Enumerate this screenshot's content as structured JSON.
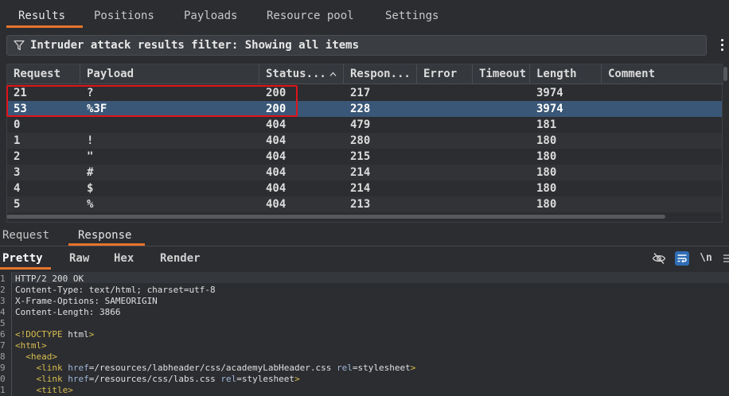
{
  "top_tabs": [
    "Results",
    "Positions",
    "Payloads",
    "Resource pool",
    "Settings"
  ],
  "filter": {
    "text": "Intruder attack results filter: Showing all items"
  },
  "table": {
    "columns": [
      "Request",
      "Payload",
      "Status...",
      "Respon...",
      "Error",
      "Timeout",
      "Length",
      "Comment"
    ],
    "sorted_column": "Status...",
    "rows": [
      {
        "request": "21",
        "payload": "?",
        "status": "200",
        "response": "217",
        "error": "",
        "timeout": "",
        "length": "3974",
        "comment": ""
      },
      {
        "request": "53",
        "payload": "%3F",
        "status": "200",
        "response": "228",
        "error": "",
        "timeout": "",
        "length": "3974",
        "comment": ""
      },
      {
        "request": "0",
        "payload": "",
        "status": "404",
        "response": "479",
        "error": "",
        "timeout": "",
        "length": "181",
        "comment": ""
      },
      {
        "request": "1",
        "payload": "!",
        "status": "404",
        "response": "280",
        "error": "",
        "timeout": "",
        "length": "180",
        "comment": ""
      },
      {
        "request": "2",
        "payload": "\"",
        "status": "404",
        "response": "215",
        "error": "",
        "timeout": "",
        "length": "180",
        "comment": ""
      },
      {
        "request": "3",
        "payload": "#",
        "status": "404",
        "response": "214",
        "error": "",
        "timeout": "",
        "length": "180",
        "comment": ""
      },
      {
        "request": "4",
        "payload": "$",
        "status": "404",
        "response": "214",
        "error": "",
        "timeout": "",
        "length": "180",
        "comment": ""
      },
      {
        "request": "5",
        "payload": "%",
        "status": "404",
        "response": "213",
        "error": "",
        "timeout": "",
        "length": "180",
        "comment": ""
      }
    ],
    "selected_request": "53"
  },
  "rr_tabs": [
    "Request",
    "Response"
  ],
  "view_tabs": [
    "Pretty",
    "Raw",
    "Hex",
    "Render"
  ],
  "toolbar": {
    "newline_label": "\\n"
  },
  "editor": {
    "lines": [
      {
        "num": "1",
        "text": "HTTP/2 200 OK"
      },
      {
        "num": "2",
        "text": "Content-Type: text/html; charset=utf-8"
      },
      {
        "num": "3",
        "text": "X-Frame-Options: SAMEORIGIN"
      },
      {
        "num": "4",
        "text": "Content-Length: 3866"
      },
      {
        "num": "5",
        "text": ""
      },
      {
        "num": "6",
        "text": "<!DOCTYPE html>"
      },
      {
        "num": "7",
        "text": "<html>"
      },
      {
        "num": "8",
        "text": "  <head>"
      },
      {
        "num": "9",
        "text": "    <link href=/resources/labheader/css/academyLabHeader.css rel=stylesheet>"
      },
      {
        "num": "0",
        "text": "    <link href=/resources/css/labs.css rel=stylesheet>"
      },
      {
        "num": "1",
        "text": "    <title>"
      }
    ]
  },
  "colors": {
    "accent": "#e8742c",
    "selected_row": "#3b5777",
    "highlight_box": "#e0141b",
    "wrap_button": "#2f6db5"
  }
}
